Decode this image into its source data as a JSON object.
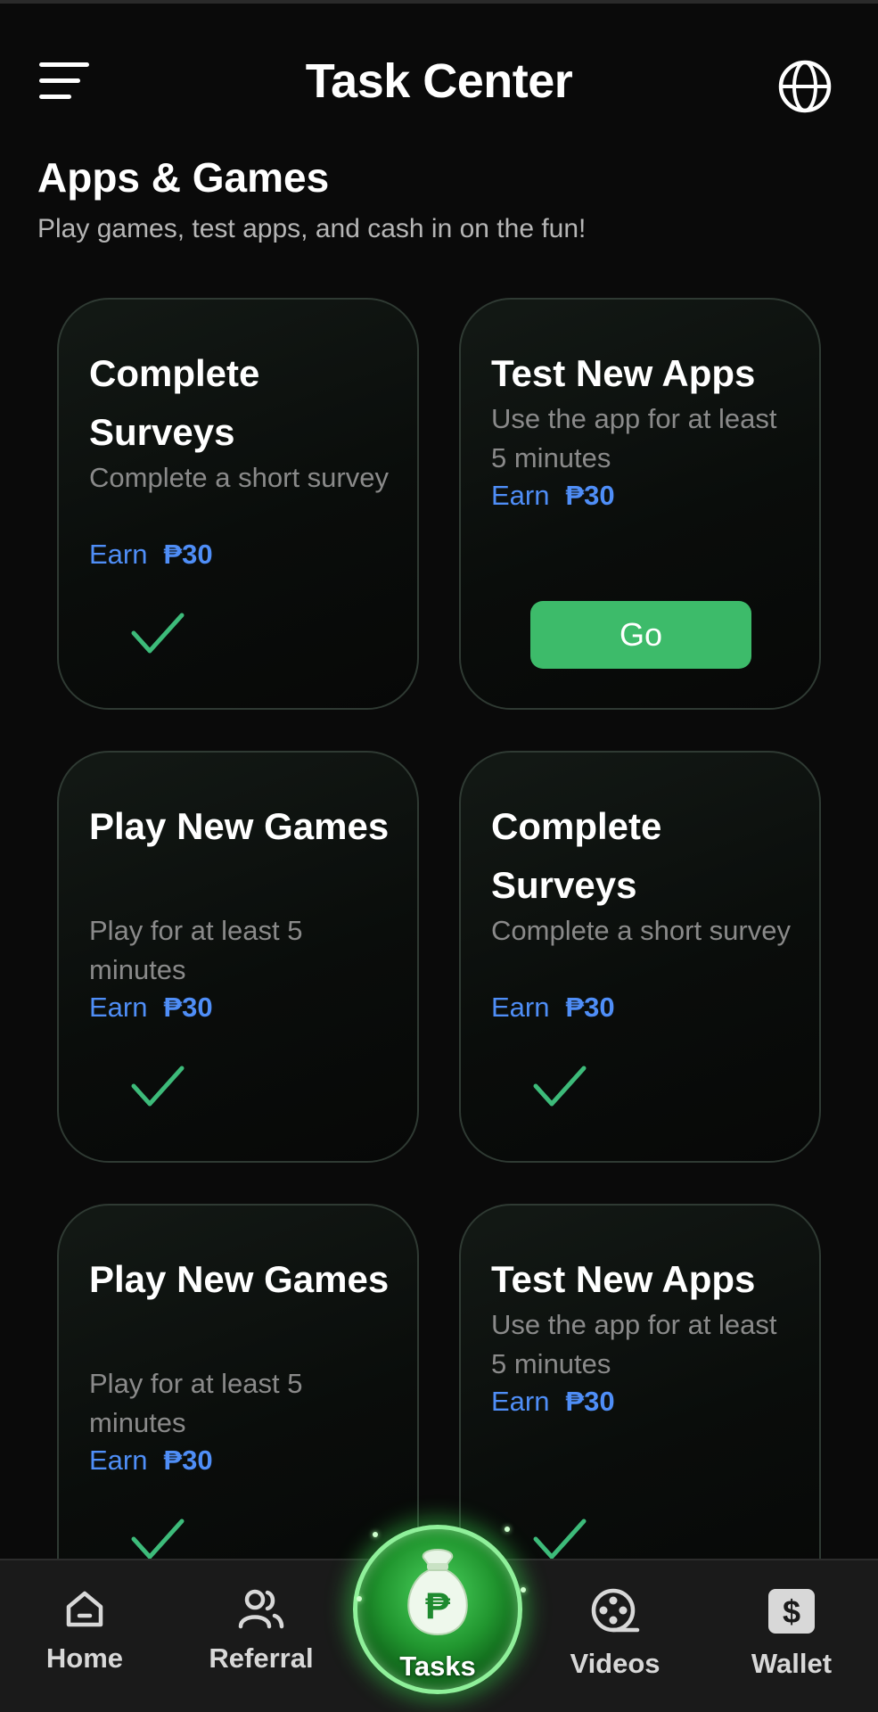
{
  "header": {
    "title": "Task Center",
    "menu_icon": "hamburger-menu-icon",
    "globe_icon": "globe-icon"
  },
  "section": {
    "title": "Apps & Games",
    "subtitle": "Play games, test apps, and cash in on the fun!"
  },
  "cards": [
    {
      "title": "Complete Surveys",
      "desc": "Complete a short survey",
      "earn_label": "Earn",
      "reward": "₱30",
      "status": "completed"
    },
    {
      "title": "Test New Apps",
      "desc": "Use the app for at least 5 minutes",
      "earn_label": "Earn",
      "reward": "₱30",
      "status": "available",
      "button": "Go"
    },
    {
      "title": "Play New Games",
      "desc": "Play for at least 5 minutes",
      "earn_label": "Earn",
      "reward": "₱30",
      "status": "completed"
    },
    {
      "title": "Complete Surveys",
      "desc": "Complete a short survey",
      "earn_label": "Earn",
      "reward": "₱30",
      "status": "completed"
    },
    {
      "title": "Play New Games",
      "desc": "Play for at least 5 minutes",
      "earn_label": "Earn",
      "reward": "₱30",
      "status": "completed"
    },
    {
      "title": "Test New Apps",
      "desc": "Use the app for at least 5 minutes",
      "earn_label": "Earn",
      "reward": "₱30",
      "status": "completed"
    }
  ],
  "nav": {
    "items": [
      {
        "label": "Home",
        "icon": "home-icon"
      },
      {
        "label": "Referral",
        "icon": "users-icon"
      },
      {
        "label": "Tasks",
        "icon": "money-bag-icon",
        "active": true
      },
      {
        "label": "Videos",
        "icon": "film-reel-icon"
      },
      {
        "label": "Wallet",
        "icon": "dollar-wallet-icon"
      }
    ]
  },
  "colors": {
    "background": "#0a0a0a",
    "accent_green": "#3dbb6a",
    "earn_blue": "#4f8ef7",
    "check_green": "#3dbb7a"
  }
}
